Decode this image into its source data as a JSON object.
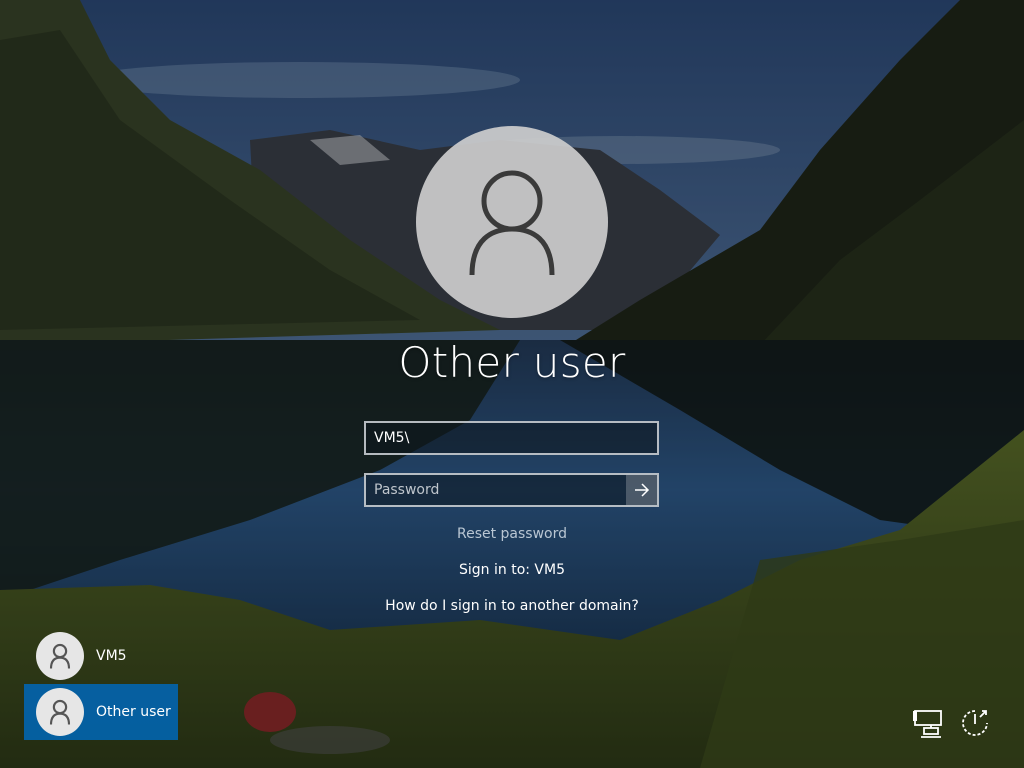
{
  "login": {
    "display_name": "Other user",
    "username_value": "VM5\\",
    "password_placeholder": "Password",
    "reset_password_label": "Reset password",
    "sign_in_to": "Sign in to: VM5",
    "domain_help": "How do I sign in to another domain?"
  },
  "users": [
    {
      "name": "VM5",
      "selected": false
    },
    {
      "name": "Other user",
      "selected": true
    }
  ],
  "icons": {
    "avatar": "person-icon",
    "submit": "arrow-right-icon",
    "network": "network-icon",
    "power": "power-icon"
  },
  "colors": {
    "selection": "#0067b8",
    "link": "#b9c6d3"
  }
}
